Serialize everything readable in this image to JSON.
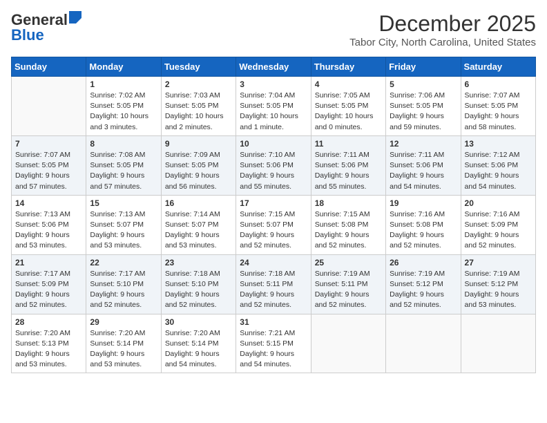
{
  "header": {
    "logo_general": "General",
    "logo_blue": "Blue",
    "month_title": "December 2025",
    "location": "Tabor City, North Carolina, United States"
  },
  "weekdays": [
    "Sunday",
    "Monday",
    "Tuesday",
    "Wednesday",
    "Thursday",
    "Friday",
    "Saturday"
  ],
  "weeks": [
    [
      {
        "day": "",
        "content": ""
      },
      {
        "day": "1",
        "content": "Sunrise: 7:02 AM\nSunset: 5:05 PM\nDaylight: 10 hours\nand 3 minutes."
      },
      {
        "day": "2",
        "content": "Sunrise: 7:03 AM\nSunset: 5:05 PM\nDaylight: 10 hours\nand 2 minutes."
      },
      {
        "day": "3",
        "content": "Sunrise: 7:04 AM\nSunset: 5:05 PM\nDaylight: 10 hours\nand 1 minute."
      },
      {
        "day": "4",
        "content": "Sunrise: 7:05 AM\nSunset: 5:05 PM\nDaylight: 10 hours\nand 0 minutes."
      },
      {
        "day": "5",
        "content": "Sunrise: 7:06 AM\nSunset: 5:05 PM\nDaylight: 9 hours\nand 59 minutes."
      },
      {
        "day": "6",
        "content": "Sunrise: 7:07 AM\nSunset: 5:05 PM\nDaylight: 9 hours\nand 58 minutes."
      }
    ],
    [
      {
        "day": "7",
        "content": "Sunrise: 7:07 AM\nSunset: 5:05 PM\nDaylight: 9 hours\nand 57 minutes."
      },
      {
        "day": "8",
        "content": "Sunrise: 7:08 AM\nSunset: 5:05 PM\nDaylight: 9 hours\nand 57 minutes."
      },
      {
        "day": "9",
        "content": "Sunrise: 7:09 AM\nSunset: 5:05 PM\nDaylight: 9 hours\nand 56 minutes."
      },
      {
        "day": "10",
        "content": "Sunrise: 7:10 AM\nSunset: 5:06 PM\nDaylight: 9 hours\nand 55 minutes."
      },
      {
        "day": "11",
        "content": "Sunrise: 7:11 AM\nSunset: 5:06 PM\nDaylight: 9 hours\nand 55 minutes."
      },
      {
        "day": "12",
        "content": "Sunrise: 7:11 AM\nSunset: 5:06 PM\nDaylight: 9 hours\nand 54 minutes."
      },
      {
        "day": "13",
        "content": "Sunrise: 7:12 AM\nSunset: 5:06 PM\nDaylight: 9 hours\nand 54 minutes."
      }
    ],
    [
      {
        "day": "14",
        "content": "Sunrise: 7:13 AM\nSunset: 5:06 PM\nDaylight: 9 hours\nand 53 minutes."
      },
      {
        "day": "15",
        "content": "Sunrise: 7:13 AM\nSunset: 5:07 PM\nDaylight: 9 hours\nand 53 minutes."
      },
      {
        "day": "16",
        "content": "Sunrise: 7:14 AM\nSunset: 5:07 PM\nDaylight: 9 hours\nand 53 minutes."
      },
      {
        "day": "17",
        "content": "Sunrise: 7:15 AM\nSunset: 5:07 PM\nDaylight: 9 hours\nand 52 minutes."
      },
      {
        "day": "18",
        "content": "Sunrise: 7:15 AM\nSunset: 5:08 PM\nDaylight: 9 hours\nand 52 minutes."
      },
      {
        "day": "19",
        "content": "Sunrise: 7:16 AM\nSunset: 5:08 PM\nDaylight: 9 hours\nand 52 minutes."
      },
      {
        "day": "20",
        "content": "Sunrise: 7:16 AM\nSunset: 5:09 PM\nDaylight: 9 hours\nand 52 minutes."
      }
    ],
    [
      {
        "day": "21",
        "content": "Sunrise: 7:17 AM\nSunset: 5:09 PM\nDaylight: 9 hours\nand 52 minutes."
      },
      {
        "day": "22",
        "content": "Sunrise: 7:17 AM\nSunset: 5:10 PM\nDaylight: 9 hours\nand 52 minutes."
      },
      {
        "day": "23",
        "content": "Sunrise: 7:18 AM\nSunset: 5:10 PM\nDaylight: 9 hours\nand 52 minutes."
      },
      {
        "day": "24",
        "content": "Sunrise: 7:18 AM\nSunset: 5:11 PM\nDaylight: 9 hours\nand 52 minutes."
      },
      {
        "day": "25",
        "content": "Sunrise: 7:19 AM\nSunset: 5:11 PM\nDaylight: 9 hours\nand 52 minutes."
      },
      {
        "day": "26",
        "content": "Sunrise: 7:19 AM\nSunset: 5:12 PM\nDaylight: 9 hours\nand 52 minutes."
      },
      {
        "day": "27",
        "content": "Sunrise: 7:19 AM\nSunset: 5:12 PM\nDaylight: 9 hours\nand 53 minutes."
      }
    ],
    [
      {
        "day": "28",
        "content": "Sunrise: 7:20 AM\nSunset: 5:13 PM\nDaylight: 9 hours\nand 53 minutes."
      },
      {
        "day": "29",
        "content": "Sunrise: 7:20 AM\nSunset: 5:14 PM\nDaylight: 9 hours\nand 53 minutes."
      },
      {
        "day": "30",
        "content": "Sunrise: 7:20 AM\nSunset: 5:14 PM\nDaylight: 9 hours\nand 54 minutes."
      },
      {
        "day": "31",
        "content": "Sunrise: 7:21 AM\nSunset: 5:15 PM\nDaylight: 9 hours\nand 54 minutes."
      },
      {
        "day": "",
        "content": ""
      },
      {
        "day": "",
        "content": ""
      },
      {
        "day": "",
        "content": ""
      }
    ]
  ]
}
